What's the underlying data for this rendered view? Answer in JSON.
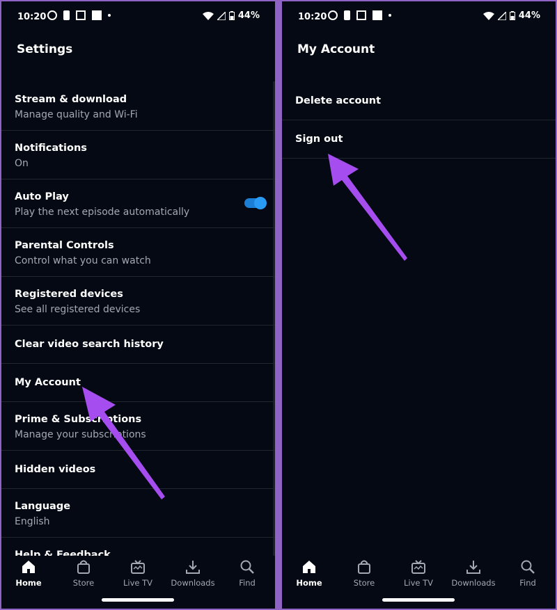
{
  "status_bar": {
    "time": "10:20",
    "battery": "44%"
  },
  "left_screen": {
    "title": "Settings",
    "items": [
      {
        "title": "Stream & download",
        "subtitle": "Manage quality and Wi-Fi"
      },
      {
        "title": "Notifications",
        "subtitle": "On"
      },
      {
        "title": "Auto Play",
        "subtitle": "Play the next episode automatically",
        "toggle_on": true
      },
      {
        "title": "Parental Controls",
        "subtitle": "Control what you can watch"
      },
      {
        "title": "Registered devices",
        "subtitle": "See all registered devices"
      },
      {
        "title": "Clear video search history"
      },
      {
        "title": "My Account"
      },
      {
        "title": "Prime & Subscriptions",
        "subtitle": "Manage your subscriptions"
      },
      {
        "title": "Hidden videos"
      },
      {
        "title": "Language",
        "subtitle": "English"
      },
      {
        "title": "Help & Feedback"
      }
    ]
  },
  "right_screen": {
    "title": "My Account",
    "items": [
      {
        "title": "Delete account"
      },
      {
        "title": "Sign out"
      }
    ]
  },
  "bottom_nav": [
    {
      "label": "Home",
      "icon": "home-icon",
      "active": true
    },
    {
      "label": "Store",
      "icon": "shopping-bag-icon"
    },
    {
      "label": "Live TV",
      "icon": "tv-icon"
    },
    {
      "label": "Downloads",
      "icon": "download-icon"
    },
    {
      "label": "Find",
      "icon": "search-icon"
    }
  ],
  "colors": {
    "background": "#050913",
    "frame": "#8f63c4",
    "accent_toggle": "#2a9bf5",
    "arrow": "#a64df0"
  }
}
